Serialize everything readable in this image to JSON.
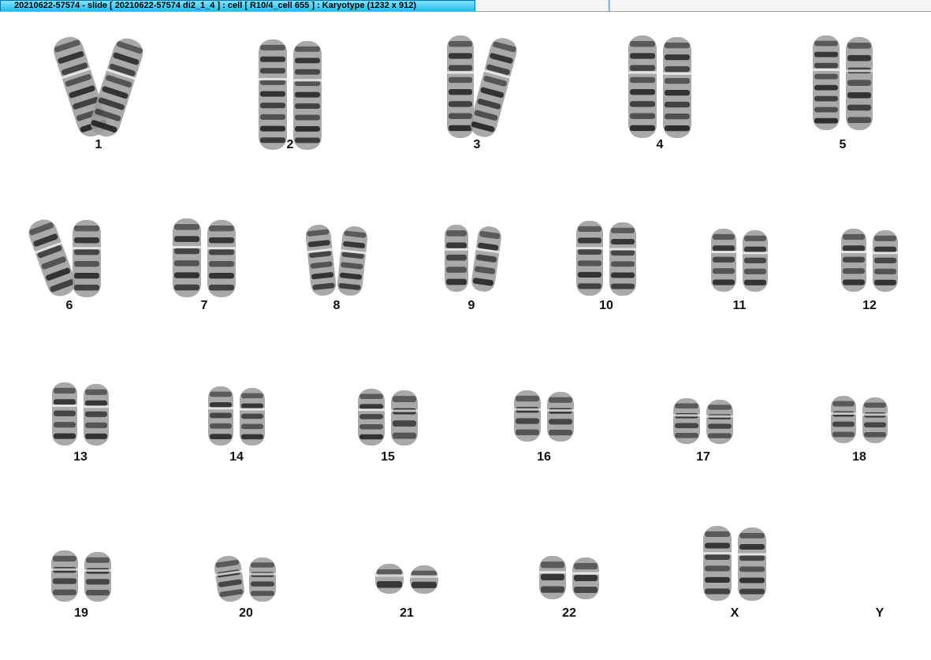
{
  "window": {
    "title": "20210622-57574 - slide [ 20210622-57574 di2_1_4 ] : cell [ R10/4_cell 655 ] : Karyotype  (1232 x 912)"
  },
  "karyotype": {
    "chromosomes": [
      {
        "label": "1"
      },
      {
        "label": "2"
      },
      {
        "label": "3"
      },
      {
        "label": "4"
      },
      {
        "label": "5"
      },
      {
        "label": "6"
      },
      {
        "label": "7"
      },
      {
        "label": "8"
      },
      {
        "label": "9"
      },
      {
        "label": "10"
      },
      {
        "label": "11"
      },
      {
        "label": "12"
      },
      {
        "label": "13"
      },
      {
        "label": "14"
      },
      {
        "label": "15"
      },
      {
        "label": "16"
      },
      {
        "label": "17"
      },
      {
        "label": "18"
      },
      {
        "label": "19"
      },
      {
        "label": "20"
      },
      {
        "label": "21"
      },
      {
        "label": "22"
      },
      {
        "label": "X"
      },
      {
        "label": "Y"
      }
    ]
  },
  "colors": {
    "tab_active": "#2ab8f0",
    "chromosome_dark": "#1a1a1a",
    "chromosome_light": "#9a9a9a",
    "background": "#ffffff"
  }
}
